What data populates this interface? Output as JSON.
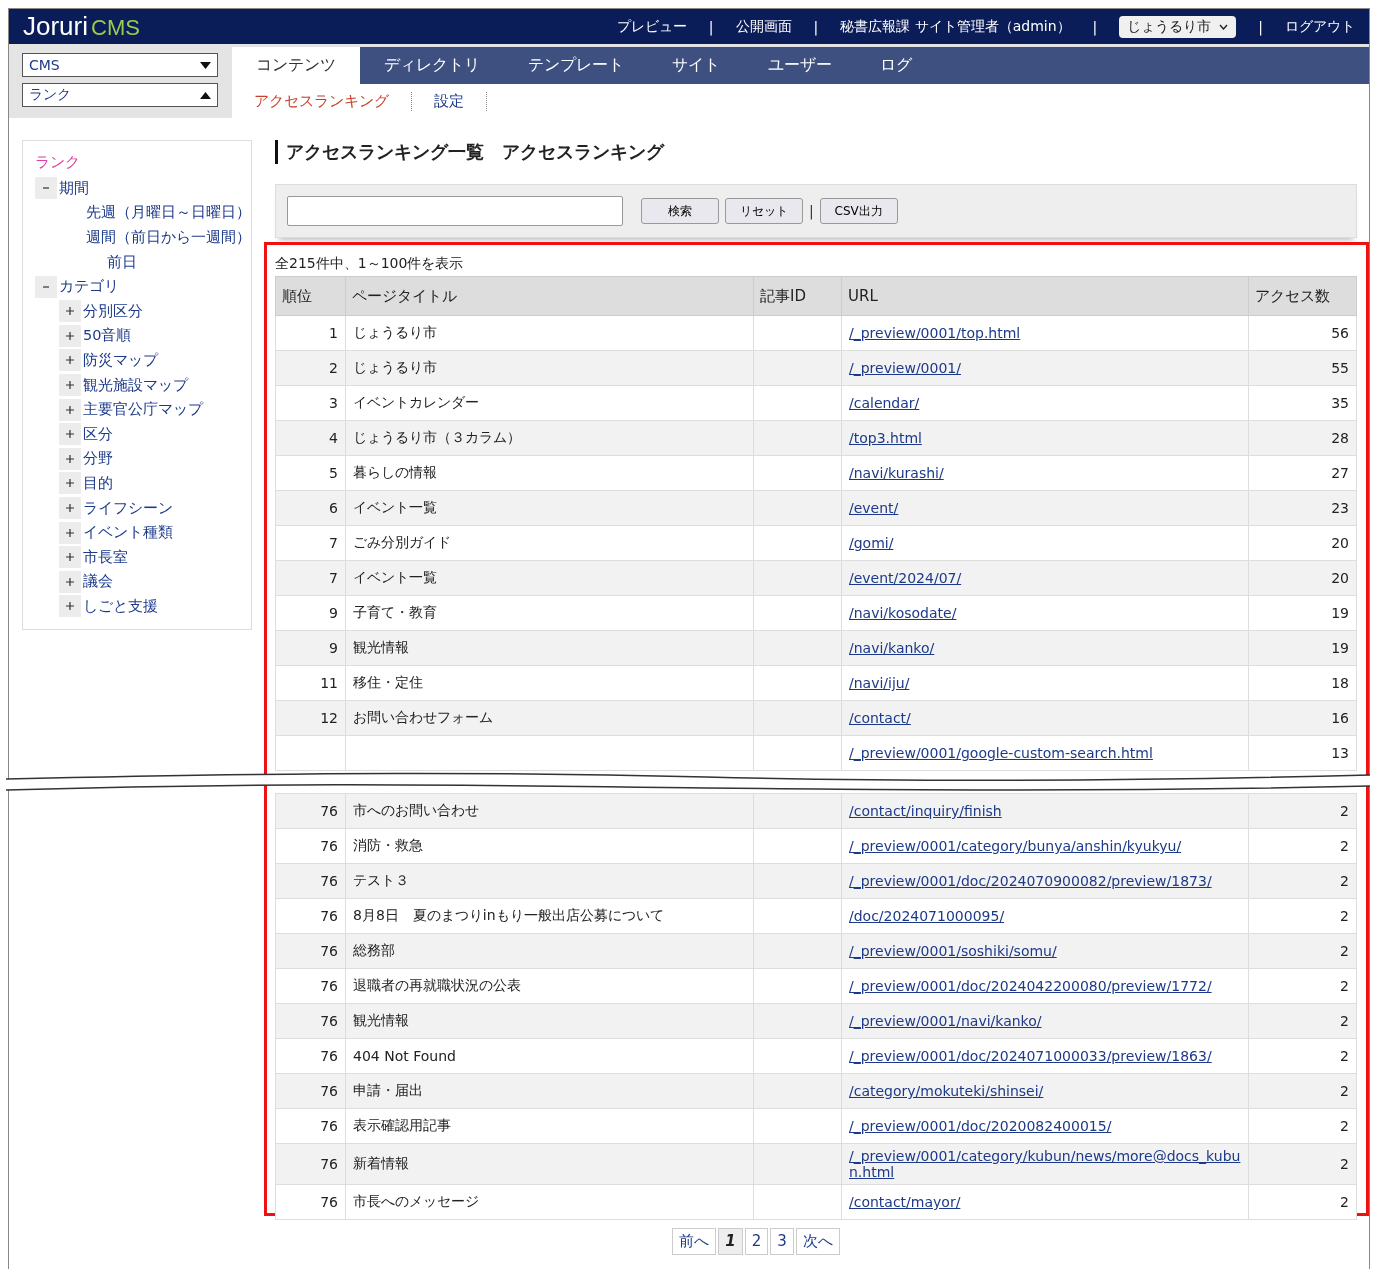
{
  "header": {
    "logo": {
      "word": "Joruri",
      "accent": "CMS"
    },
    "items": [
      {
        "kind": "link",
        "label": "プレビュー"
      },
      {
        "kind": "link",
        "label": "公開画面"
      },
      {
        "kind": "text",
        "label": "秘書広報課 サイト管理者（admin）"
      },
      {
        "kind": "select",
        "label": "じょうるり市"
      },
      {
        "kind": "link",
        "label": "ログアウト"
      }
    ],
    "separator": "|"
  },
  "selects": [
    {
      "value": "CMS",
      "open": false
    },
    {
      "value": "ランク",
      "open": true
    }
  ],
  "tabs": [
    {
      "label": "コンテンツ",
      "selected": true
    },
    {
      "label": "ディレクトリ",
      "selected": false
    },
    {
      "label": "テンプレート",
      "selected": false
    },
    {
      "label": "サイト",
      "selected": false
    },
    {
      "label": "ユーザー",
      "selected": false
    },
    {
      "label": "ログ",
      "selected": false
    }
  ],
  "subnav": [
    {
      "label": "アクセスランキング",
      "selected": true
    },
    {
      "label": "設定",
      "selected": false
    }
  ],
  "sidebar": {
    "title": "ランク",
    "tree": [
      {
        "label": "期間",
        "expanded": true,
        "children": [
          {
            "label": "先週（月曜日～日曜日）"
          },
          {
            "label": "週間（前日から一週間）"
          },
          {
            "label": "前日"
          }
        ]
      },
      {
        "label": "カテゴリ",
        "expanded": true,
        "children": [
          {
            "label": "分別区分",
            "expanded": false
          },
          {
            "label": "50音順",
            "expanded": false
          },
          {
            "label": "防災マップ",
            "expanded": false
          },
          {
            "label": "観光施設マップ",
            "expanded": false
          },
          {
            "label": "主要官公庁マップ",
            "expanded": false
          },
          {
            "label": "区分",
            "expanded": false
          },
          {
            "label": "分野",
            "expanded": false
          },
          {
            "label": "目的",
            "expanded": false
          },
          {
            "label": "ライフシーン",
            "expanded": false
          },
          {
            "label": "イベント種類",
            "expanded": false
          },
          {
            "label": "市長室",
            "expanded": false
          },
          {
            "label": "議会",
            "expanded": false
          },
          {
            "label": "しごと支援",
            "expanded": false
          }
        ]
      }
    ]
  },
  "heading": {
    "title": "アクセスランキング一覧",
    "subtitle": "アクセスランキング"
  },
  "search": {
    "buttons": [
      "検索",
      "リセット",
      "CSV出力"
    ],
    "separator": "|"
  },
  "summary": "全215件中、1～100件を表示",
  "table": {
    "columns": [
      "順位",
      "ページタイトル",
      "記事ID",
      "URL",
      "アクセス数"
    ],
    "rows": [
      {
        "rank": "1",
        "title": "じょうるり市",
        "url": "/_preview/0001/top.html",
        "count": "56"
      },
      {
        "rank": "2",
        "title": "じょうるり市",
        "url": "/_preview/0001/",
        "count": "55"
      },
      {
        "rank": "3",
        "title": "イベントカレンダー",
        "url": "/calendar/",
        "count": "35"
      },
      {
        "rank": "4",
        "title": "じょうるり市（３カラム）",
        "url": "/top3.html",
        "count": "28"
      },
      {
        "rank": "5",
        "title": "暮らしの情報",
        "url": "/navi/kurashi/",
        "count": "27"
      },
      {
        "rank": "6",
        "title": "イベント一覧",
        "url": "/event/",
        "count": "23"
      },
      {
        "rank": "7",
        "title": "ごみ分別ガイド",
        "url": "/gomi/",
        "count": "20"
      },
      {
        "rank": "7",
        "title": "イベント一覧",
        "url": "/event/2024/07/",
        "count": "20"
      },
      {
        "rank": "9",
        "title": "子育て・教育",
        "url": "/navi/kosodate/",
        "count": "19"
      },
      {
        "rank": "9",
        "title": "観光情報",
        "url": "/navi/kanko/",
        "count": "19"
      },
      {
        "rank": "11",
        "title": "移住・定住",
        "url": "/navi/iju/",
        "count": "18"
      },
      {
        "rank": "12",
        "title": "お問い合わせフォーム",
        "url": "/contact/",
        "count": "16"
      },
      {
        "url": "/_preview/0001/google-custom-search.html",
        "count": "13",
        "torn": true
      },
      {
        "rank": "76",
        "title": "市へのお問い合わせ",
        "url": "/contact/inquiry/finish",
        "count": "2"
      },
      {
        "rank": "76",
        "title": "消防・救急",
        "url": "/_preview/0001/category/bunya/anshin/kyukyu/",
        "count": "2"
      },
      {
        "rank": "76",
        "title": "テスト３",
        "url": "/_preview/0001/doc/2024070900082/preview/1873/",
        "count": "2"
      },
      {
        "rank": "76",
        "title": "8月8日　夏のまつりinもり一般出店公募について",
        "url": "/doc/2024071000095/",
        "count": "2"
      },
      {
        "rank": "76",
        "title": "総務部",
        "url": "/_preview/0001/soshiki/somu/",
        "count": "2"
      },
      {
        "rank": "76",
        "title": "退職者の再就職状況の公表",
        "url": "/_preview/0001/doc/2024042200080/preview/1772/",
        "count": "2"
      },
      {
        "rank": "76",
        "title": "観光情報",
        "url": "/_preview/0001/navi/kanko/",
        "count": "2"
      },
      {
        "rank": "76",
        "title": "404 Not Found",
        "url": "/_preview/0001/doc/2024071000033/preview/1863/",
        "count": "2"
      },
      {
        "rank": "76",
        "title": "申請・届出",
        "url": "/category/mokuteki/shinsei/",
        "count": "2"
      },
      {
        "rank": "76",
        "title": "表示確認用記事",
        "url": "/_preview/0001/doc/2020082400015/",
        "count": "2"
      },
      {
        "rank": "76",
        "title": "新着情報",
        "url": "/_preview/0001/category/kubun/news/more@docs_kubun.html",
        "count": "2"
      },
      {
        "rank": "76",
        "title": "市長へのメッセージ",
        "url": "/contact/mayor/",
        "count": "2"
      }
    ]
  },
  "pagination": {
    "prev": "前へ",
    "pages": [
      {
        "label": "1",
        "selected": true
      },
      {
        "label": "2",
        "selected": false
      },
      {
        "label": "3",
        "selected": false
      }
    ],
    "next": "次へ"
  }
}
